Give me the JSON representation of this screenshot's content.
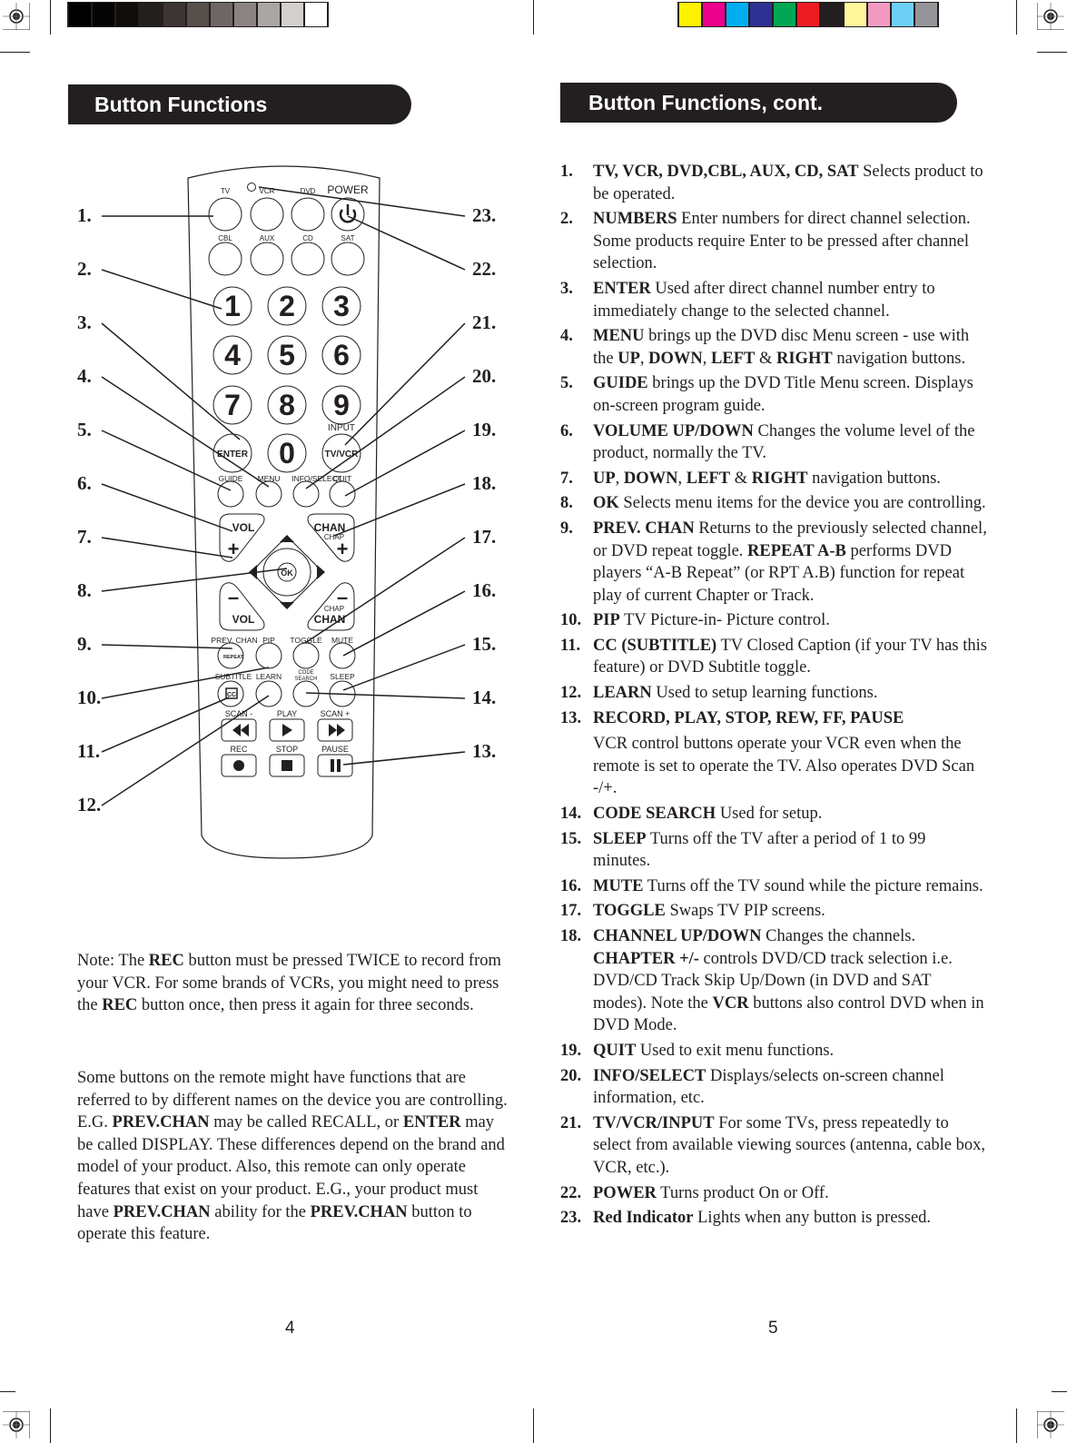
{
  "color_bars": {
    "grayscale": [
      "#000000",
      "#050505",
      "#120c0a",
      "#231f1d",
      "#3d3533",
      "#574f4c",
      "#6e6663",
      "#8a8381",
      "#aba6a3",
      "#d3cfcd",
      "#ffffff"
    ],
    "colors": [
      "#fff200",
      "#ec008c",
      "#00aeef",
      "#2e3192",
      "#00a651",
      "#ed1c24",
      "#231f20",
      "#fff799",
      "#f49ac1",
      "#6dcff6",
      "#939598"
    ]
  },
  "left_page": {
    "header": "Button Functions",
    "page_number": "4",
    "callouts_left": [
      "1.",
      "2.",
      "3.",
      "4.",
      "5.",
      "6.",
      "7.",
      "8.",
      "9.",
      "10.",
      "11.",
      "12."
    ],
    "callouts_right": [
      "23.",
      "22.",
      "21.",
      "20.",
      "19.",
      "18.",
      "17.",
      "16.",
      "15.",
      "14.",
      "13."
    ],
    "remote": {
      "source_labels": [
        "TV",
        "VCR",
        "DVD",
        "POWER",
        "CBL",
        "AUX",
        "CD",
        "SAT"
      ],
      "digits": [
        "1",
        "2",
        "3",
        "4",
        "5",
        "6",
        "7",
        "8",
        "9",
        "ENTER",
        "0",
        "TV/VCR"
      ],
      "input_label": "INPUT",
      "row_labels": [
        "GUIDE",
        "MENU",
        "INFO/SELECT",
        "QUIT"
      ],
      "vol_label": "VOL",
      "chan_label": "CHAN",
      "chap_label": "CHAP",
      "ok_label": "OK",
      "row2_labels": [
        "PREV. CHAN",
        "PIP",
        "TOGGLE",
        "MUTE"
      ],
      "repeat_label": "REPEAT",
      "row3_labels": [
        "SUBTITLE",
        "LEARN",
        "CODE SEARCH",
        "SLEEP"
      ],
      "cc_label": "CC",
      "transport_labels": [
        "SCAN -",
        "PLAY",
        "SCAN +",
        "REC",
        "STOP",
        "PAUSE"
      ]
    },
    "note_parts": [
      {
        "t": "Note: The ",
        "b": false
      },
      {
        "t": "REC",
        "b": true
      },
      {
        "t": " button must be pressed TWICE to record from your VCR. For some brands of VCRs, you might need to press the ",
        "b": false
      },
      {
        "t": "REC",
        "b": true
      },
      {
        "t": " button once, then press it again for three seconds.",
        "b": false
      }
    ],
    "paragraph_parts": [
      {
        "t": "Some buttons on the remote might have functions that are referred to by different names on the device you are controlling. E.G.  ",
        "b": false
      },
      {
        "t": "PREV.CHAN",
        "b": true
      },
      {
        "t": " may be called RECALL, or ",
        "b": false
      },
      {
        "t": "ENTER",
        "b": true
      },
      {
        "t": " may be called DISPLAY. These differences depend on the brand and model of your product. Also, this remote can only operate features that exist on your product. E.G., your product must have ",
        "b": false
      },
      {
        "t": "PREV.CHAN",
        "b": true
      },
      {
        "t": " ability for the ",
        "b": false
      },
      {
        "t": "PREV.CHAN",
        "b": true
      },
      {
        "t": " button to operate this feature.",
        "b": false
      }
    ]
  },
  "right_page": {
    "header": "Button Functions, cont.",
    "page_number": "5",
    "items": [
      {
        "num": "1.",
        "parts": [
          {
            "t": "TV, VCR, DVD,CBL, AUX, CD, SAT",
            "b": true
          },
          {
            "t": " Selects product to be operated.",
            "b": false
          }
        ]
      },
      {
        "num": "2.",
        "parts": [
          {
            "t": "NUMBERS",
            "b": true
          },
          {
            "t": " Enter numbers for direct channel selection. Some products require Enter to be pressed after channel selection.",
            "b": false
          }
        ]
      },
      {
        "num": "3.",
        "parts": [
          {
            "t": "ENTER",
            "b": true
          },
          {
            "t": " Used after direct channel number entry to immediately change to the selected channel.",
            "b": false
          }
        ]
      },
      {
        "num": "4.",
        "parts": [
          {
            "t": "MENU",
            "b": true
          },
          {
            "t": " brings up the DVD disc Menu screen - use with the ",
            "b": false
          },
          {
            "t": "UP",
            "b": true
          },
          {
            "t": ", ",
            "b": false
          },
          {
            "t": "DOWN",
            "b": true
          },
          {
            "t": ", ",
            "b": false
          },
          {
            "t": "LEFT",
            "b": true
          },
          {
            "t": " & ",
            "b": false
          },
          {
            "t": "RIGHT",
            "b": true
          },
          {
            "t": " navigation buttons.",
            "b": false
          }
        ]
      },
      {
        "num": "5.",
        "parts": [
          {
            "t": "GUIDE",
            "b": true
          },
          {
            "t": " brings up the DVD Title Menu screen. Displays on-screen program guide.",
            "b": false
          }
        ]
      },
      {
        "num": "6.",
        "parts": [
          {
            "t": "VOLUME UP/DOWN",
            "b": true
          },
          {
            "t": " Changes the volume level of the product, normally the TV.",
            "b": false
          }
        ]
      },
      {
        "num": "7.",
        "parts": [
          {
            "t": "UP",
            "b": true
          },
          {
            "t": ", ",
            "b": false
          },
          {
            "t": "DOWN",
            "b": true
          },
          {
            "t": ", ",
            "b": false
          },
          {
            "t": "LEFT",
            "b": true
          },
          {
            "t": " & ",
            "b": false
          },
          {
            "t": "RIGHT",
            "b": true
          },
          {
            "t": " navigation buttons.",
            "b": false
          }
        ]
      },
      {
        "num": "8.",
        "parts": [
          {
            "t": "OK",
            "b": true
          },
          {
            "t": " Selects menu items for the device you are controlling.",
            "b": false
          }
        ]
      },
      {
        "num": "9.",
        "parts": [
          {
            "t": "PREV. CHAN",
            "b": true
          },
          {
            "t": " Returns to the previously selected channel, or DVD repeat toggle. ",
            "b": false
          },
          {
            "t": "REPEAT A-B",
            "b": true
          },
          {
            "t": " performs DVD players “A-B Repeat” (or RPT A.B) function for repeat play of current Chapter or Track.",
            "b": false
          }
        ]
      },
      {
        "num": "10.",
        "parts": [
          {
            "t": "PIP",
            "b": true
          },
          {
            "t": " TV Picture-in- Picture control.",
            "b": false
          }
        ]
      },
      {
        "num": "11.",
        "parts": [
          {
            "t": "CC (SUBTITLE)",
            "b": true
          },
          {
            "t": " TV Closed Caption (if your TV has this feature) or DVD Subtitle toggle.",
            "b": false
          }
        ]
      },
      {
        "num": "12.",
        "parts": [
          {
            "t": "LEARN",
            "b": true
          },
          {
            "t": " Used to setup learning functions.",
            "b": false
          }
        ]
      },
      {
        "num": "13.",
        "parts": [
          {
            "t": "RECORD, PLAY, STOP, REW, FF, PAUSE",
            "b": true
          }
        ],
        "continuation": "VCR control buttons operate your VCR even when the remote is set to operate the TV. Also operates DVD Scan -/+."
      },
      {
        "num": "14.",
        "parts": [
          {
            "t": "CODE SEARCH",
            "b": true
          },
          {
            "t": " Used for setup.",
            "b": false
          }
        ]
      },
      {
        "num": "15.",
        "parts": [
          {
            "t": "SLEEP",
            "b": true
          },
          {
            "t": " Turns off the TV after a period of 1 to 99 minutes.",
            "b": false
          }
        ]
      },
      {
        "num": "16.",
        "parts": [
          {
            "t": "MUTE",
            "b": true
          },
          {
            "t": " Turns off the TV sound while the picture remains.",
            "b": false
          }
        ]
      },
      {
        "num": "17.",
        "parts": [
          {
            "t": "TOGGLE",
            "b": true
          },
          {
            "t": " Swaps TV PIP screens.",
            "b": false
          }
        ]
      },
      {
        "num": "18.",
        "parts": [
          {
            "t": "CHANNEL UP/DOWN",
            "b": true
          },
          {
            "t": " Changes the channels. ",
            "b": false
          },
          {
            "t": "CHAPTER +/-",
            "b": true
          },
          {
            "t": " controls DVD/CD track selection i.e. DVD/CD Track Skip Up/Down (in DVD and SAT modes). Note the ",
            "b": false
          },
          {
            "t": "VCR",
            "b": true
          },
          {
            "t": " buttons also control DVD when in DVD Mode.",
            "b": false
          }
        ]
      },
      {
        "num": "19.",
        "parts": [
          {
            "t": "QUIT",
            "b": true
          },
          {
            "t": " Used to exit menu functions.",
            "b": false
          }
        ]
      },
      {
        "num": "20.",
        "parts": [
          {
            "t": "INFO/SELECT",
            "b": true
          },
          {
            "t": " Displays/selects on-screen channel information, etc.",
            "b": false
          }
        ]
      },
      {
        "num": "21.",
        "parts": [
          {
            "t": "TV/VCR/INPUT",
            "b": true
          },
          {
            "t": " For some TVs, press repeatedly to select from available viewing sources (antenna, cable box, VCR, etc.).",
            "b": false
          }
        ]
      },
      {
        "num": "22.",
        "parts": [
          {
            "t": "POWER",
            "b": true
          },
          {
            "t": " Turns product On or Off.",
            "b": false
          }
        ]
      },
      {
        "num": "23.",
        "parts": [
          {
            "t": "Red Indicator",
            "b": true
          },
          {
            "t": " Lights when any button is pressed.",
            "b": false
          }
        ]
      }
    ]
  }
}
